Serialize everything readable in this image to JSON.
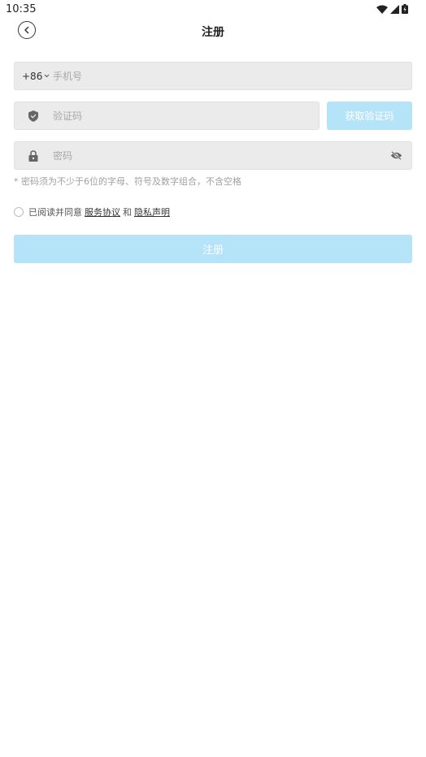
{
  "status_bar": {
    "time": "10:35",
    "icons": [
      "wifi-icon",
      "signal-icon",
      "battery-icon"
    ]
  },
  "nav": {
    "back_icon": "chevron-left-icon",
    "title": "注册"
  },
  "form": {
    "phone": {
      "country_code": "+86",
      "dropdown_icon": "chevron-down-icon",
      "placeholder": "手机号",
      "value": ""
    },
    "code": {
      "icon": "shield-icon",
      "placeholder": "验证码",
      "value": "",
      "get_code_label": "获取验证码"
    },
    "password": {
      "icon": "lock-icon",
      "placeholder": "密码",
      "value": "",
      "visibility_icon": "eye-off-icon"
    },
    "hint": "* 密码须为不少于6位的字母、符号及数字组合，不含空格",
    "agreement": {
      "checked": false,
      "prefix": "已阅读并同意",
      "terms_label": "服务协议",
      "joiner": "和",
      "privacy_label": "隐私声明"
    },
    "submit_label": "注册"
  },
  "colors": {
    "accent_disabled": "#b5e3f8",
    "field_bg": "#ebebeb",
    "placeholder": "#a8a8a8"
  }
}
